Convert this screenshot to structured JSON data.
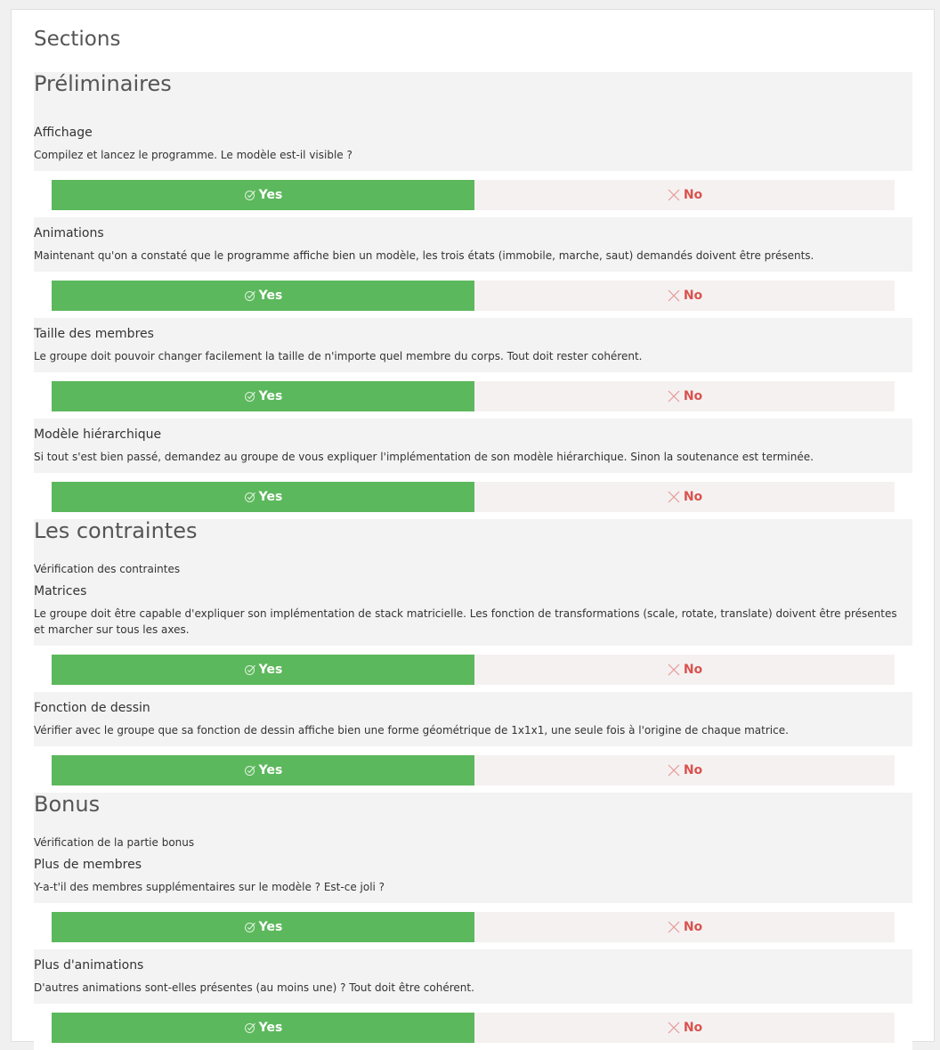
{
  "page": {
    "title": "Sections"
  },
  "buttons": {
    "yes_label": "Yes",
    "no_label": "No"
  },
  "colors": {
    "yes": "#5cb85c",
    "no": "#d9534f",
    "no_bg": "#f5f1f1",
    "section_bg": "#f3f3f3"
  },
  "icons": {
    "yes": "check-circle-icon",
    "no": "cross-icon"
  },
  "sections": [
    {
      "title": "Préliminaires",
      "description": "",
      "questions": [
        {
          "title": "Affichage",
          "description": "Compilez et lancez le programme. Le modèle est-il visible ?"
        },
        {
          "title": "Animations",
          "description": "Maintenant qu'on a constaté que le programme affiche bien un modèle, les trois états (immobile, marche, saut) demandés doivent être présents."
        },
        {
          "title": "Taille des membres",
          "description": "Le groupe doit pouvoir changer facilement la taille de n'importe quel membre du corps. Tout doit rester cohérent."
        },
        {
          "title": "Modèle hiérarchique",
          "description": "Si tout s'est bien passé, demandez au groupe de vous expliquer l'implémentation de son modèle hiérarchique. Sinon la soutenance est terminée."
        }
      ]
    },
    {
      "title": "Les contraintes",
      "description": "Vérification des contraintes",
      "questions": [
        {
          "title": "Matrices",
          "description": "Le groupe doit être capable d'expliquer son implémentation de stack matricielle. Les fonction de transformations (scale, rotate, translate) doivent être présentes et marcher sur tous les axes."
        },
        {
          "title": "Fonction de dessin",
          "description": "Vérifier avec le groupe que sa fonction de dessin affiche bien une forme géométrique de 1x1x1, une seule fois à l'origine de chaque matrice."
        }
      ]
    },
    {
      "title": "Bonus",
      "description": "Vérification de la partie bonus",
      "questions": [
        {
          "title": "Plus de membres",
          "description": "Y-a-t'il des membres supplémentaires sur le modèle ? Est-ce joli ?"
        },
        {
          "title": "Plus d'animations",
          "description": "D'autres animations sont-elles présentes (au moins une) ? Tout doit être cohérent."
        }
      ]
    }
  ]
}
